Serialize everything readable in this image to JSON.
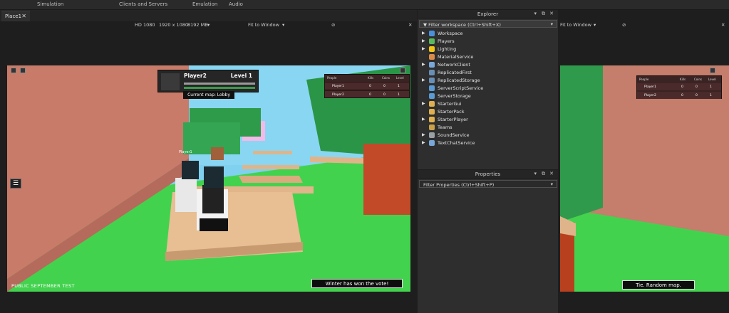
{
  "ribbon": {
    "items": [
      "Simulation",
      "Clients and Servers",
      "Emulation",
      "Audio"
    ]
  },
  "doc_tab": {
    "label": "Place1",
    "close": "✕"
  },
  "viewport_bar": {
    "resolution": "HD 1080",
    "size": "1920 x 1080",
    "memory": "8192 MB",
    "fit": "Fit to Window",
    "close": "✕"
  },
  "viewport_bar2": {
    "fit": "Fit to Window",
    "close": "✕"
  },
  "hud": {
    "player": "Player2",
    "level": "Level 1",
    "current_map": "Current map: Lobby"
  },
  "leaderboard": {
    "headers": [
      "People",
      "Kills",
      "Coins",
      "Level"
    ],
    "rows": [
      [
        "Player1",
        "0",
        "0",
        "1"
      ],
      [
        "Player2",
        "0",
        "0",
        "1"
      ]
    ]
  },
  "leaderboard2": {
    "headers": [
      "People",
      "Kills",
      "Coins",
      "Level"
    ],
    "rows": [
      [
        "Player1",
        "0",
        "0",
        "1"
      ],
      [
        "Player2",
        "0",
        "0",
        "1"
      ]
    ]
  },
  "overhead_name": "Player1",
  "test_label": "PUBLIC SEPTEMBER TEST",
  "toast_left": "Winter has won the vote!",
  "toast_right": "Tie. Random map.",
  "explorer": {
    "title": "Explorer",
    "filter_placeholder": "Filter workspace (Ctrl+Shift+X)",
    "items": [
      {
        "label": "Workspace",
        "expandable": true,
        "color": "#4a90d9"
      },
      {
        "label": "Players",
        "expandable": true,
        "color": "#5cb85c"
      },
      {
        "label": "Lighting",
        "expandable": true,
        "color": "#f0c419"
      },
      {
        "label": "MaterialService",
        "expandable": false,
        "color": "#d98c4a"
      },
      {
        "label": "NetworkClient",
        "expandable": true,
        "color": "#7aa7d9"
      },
      {
        "label": "ReplicatedFirst",
        "expandable": false,
        "color": "#6a8fb5"
      },
      {
        "label": "ReplicatedStorage",
        "expandable": true,
        "color": "#6a8fb5"
      },
      {
        "label": "ServerScriptService",
        "expandable": false,
        "color": "#5a9bd5"
      },
      {
        "label": "ServerStorage",
        "expandable": false,
        "color": "#5a9bd5"
      },
      {
        "label": "StarterGui",
        "expandable": true,
        "color": "#e0b050"
      },
      {
        "label": "StarterPack",
        "expandable": false,
        "color": "#e0b050"
      },
      {
        "label": "StarterPlayer",
        "expandable": true,
        "color": "#e0b050"
      },
      {
        "label": "Teams",
        "expandable": false,
        "color": "#c9a14a"
      },
      {
        "label": "SoundService",
        "expandable": true,
        "color": "#9aa0a6"
      },
      {
        "label": "TextChatService",
        "expandable": true,
        "color": "#7aa7d9"
      }
    ]
  },
  "properties": {
    "title": "Properties",
    "filter_placeholder": "Filter Properties (Ctrl+Shift+P)"
  }
}
